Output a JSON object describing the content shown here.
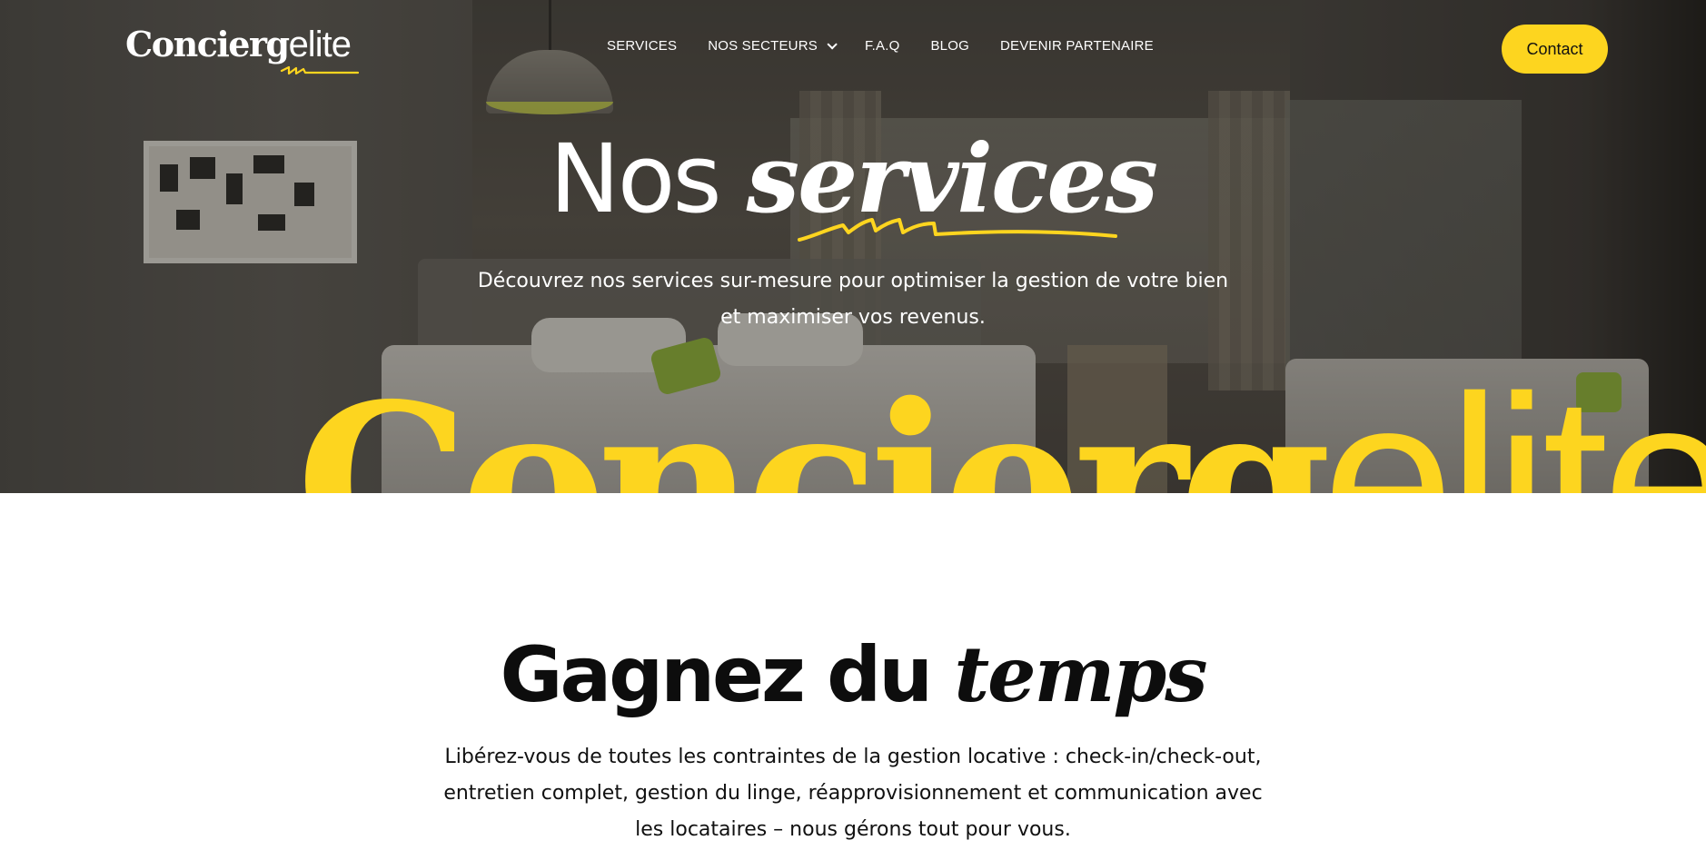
{
  "brand": {
    "name_strong": "Concierg",
    "name_light": "elite",
    "accent_color": "#fdd51f"
  },
  "nav": {
    "items": [
      {
        "label": "SERVICES"
      },
      {
        "label": "NOS SECTEURS",
        "has_dropdown": true
      },
      {
        "label": "F.A.Q"
      },
      {
        "label": "BLOG"
      },
      {
        "label": "DEVENIR PARTENAIRE"
      }
    ],
    "contact_label": "Contact",
    "dropdown_icon": "chevron-down-icon"
  },
  "hero": {
    "title_plain": "Nos ",
    "title_script": "services",
    "subtitle": "Découvrez nos services sur-mesure pour optimiser la gestion de votre bien et maximiser vos revenus.",
    "big_brand_strong": "Concierg",
    "big_brand_light": "elite"
  },
  "section": {
    "title_plain": "Gagnez du ",
    "title_script": "temps",
    "text": "Libérez-vous de toutes les contraintes de la gestion locative : check-in/check-out, entretien complet, gestion du linge, réapprovisionnement et communication avec les locataires – nous gérons tout pour vous."
  }
}
